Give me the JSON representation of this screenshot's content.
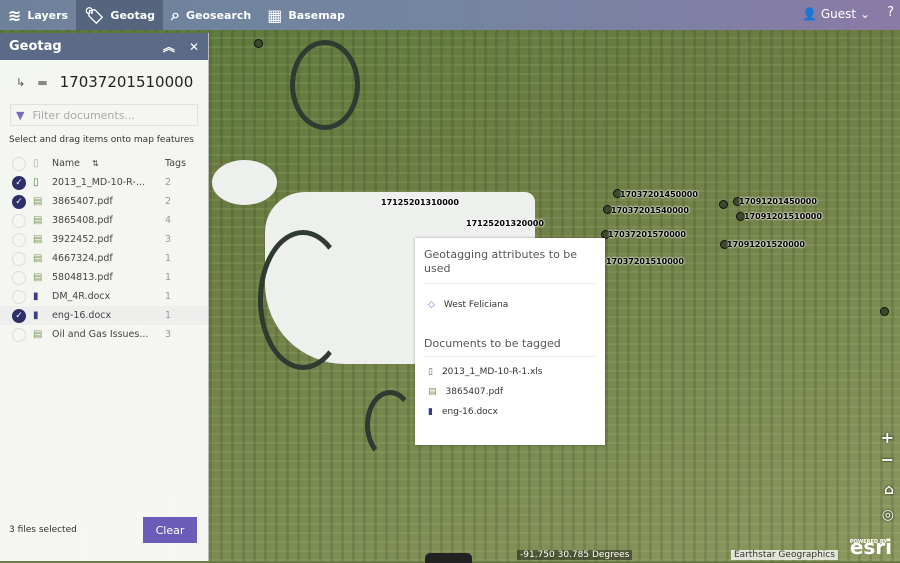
{
  "topbar": {
    "tabs": [
      {
        "label": "Layers",
        "icon": "layers-icon"
      },
      {
        "label": "Geotag",
        "icon": "tag-icon"
      },
      {
        "label": "Geosearch",
        "icon": "geosearch-icon"
      },
      {
        "label": "Basemap",
        "icon": "grid-icon"
      }
    ],
    "user": "Guest",
    "help": "?"
  },
  "panel": {
    "title": "Geotag",
    "folder": "17037201510000",
    "filter_placeholder": "Filter documents...",
    "hint": "Select and drag items onto map features",
    "col_name": "Name",
    "col_tags": "Tags",
    "files": [
      {
        "name": "2013_1_MD-10-R-...",
        "tags": "2",
        "checked": true,
        "type": "xls"
      },
      {
        "name": "3865407.pdf",
        "tags": "2",
        "checked": true,
        "type": "pdf"
      },
      {
        "name": "3865408.pdf",
        "tags": "4",
        "checked": false,
        "type": "pdf"
      },
      {
        "name": "3922452.pdf",
        "tags": "3",
        "checked": false,
        "type": "pdf"
      },
      {
        "name": "4667324.pdf",
        "tags": "1",
        "checked": false,
        "type": "pdf"
      },
      {
        "name": "5804813.pdf",
        "tags": "1",
        "checked": false,
        "type": "pdf"
      },
      {
        "name": "DM_4R.docx",
        "tags": "1",
        "checked": false,
        "type": "docx"
      },
      {
        "name": "eng-16.docx",
        "tags": "1",
        "checked": true,
        "type": "docx"
      },
      {
        "name": "Oil and Gas Issues...",
        "tags": "3",
        "checked": false,
        "type": "pdf"
      }
    ],
    "selected": "3 files selected",
    "clear": "Clear"
  },
  "popup": {
    "title": "Geotagging attributes to be used",
    "attribute": "West Feliciana",
    "docs_title": "Documents to be tagged",
    "docs": [
      "2013_1_MD-10-R-1.xls",
      "3865407.pdf",
      "eng-16.docx"
    ]
  },
  "map": {
    "labels": [
      "17125201310000",
      "17125201320000",
      "17037201450000",
      "17037201540000",
      "17037201570000",
      "17037201510000",
      "17091201450000",
      "17091201510000",
      "17091201520000"
    ],
    "coords": "-91.750 30.785 Degrees",
    "attribution": "Earthstar Geographics",
    "powered": "POWERED BY",
    "esri": "esri"
  }
}
